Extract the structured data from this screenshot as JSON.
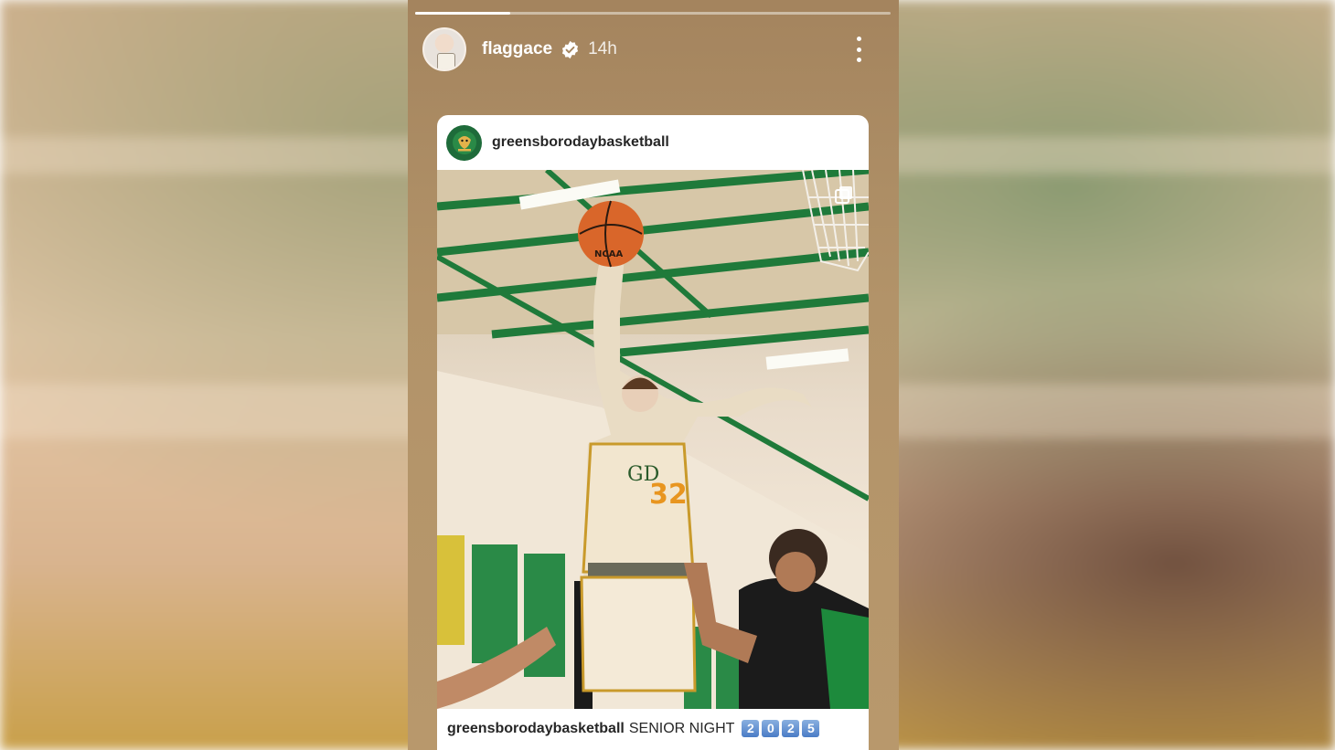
{
  "story": {
    "progress": 0.2,
    "username": "flaggace",
    "verified": true,
    "time_ago": "14h",
    "icons": {
      "verified": "verified-badge-icon",
      "more": "more-options-icon",
      "multi_image": "carousel-icon"
    }
  },
  "shared_post": {
    "account": "greensborodaybasketball",
    "caption": {
      "username": "greensborodaybasketball",
      "text": "SENIOR NIGHT",
      "year_digits": [
        "2",
        "0",
        "2",
        "5"
      ]
    },
    "photo": {
      "jersey_number": "32",
      "ball_marking": "NCAA"
    }
  },
  "colors": {
    "story_bg": "#b29369",
    "gym_green": "#1f7a3a",
    "card_bg": "#ffffff",
    "text_primary": "#262626"
  }
}
